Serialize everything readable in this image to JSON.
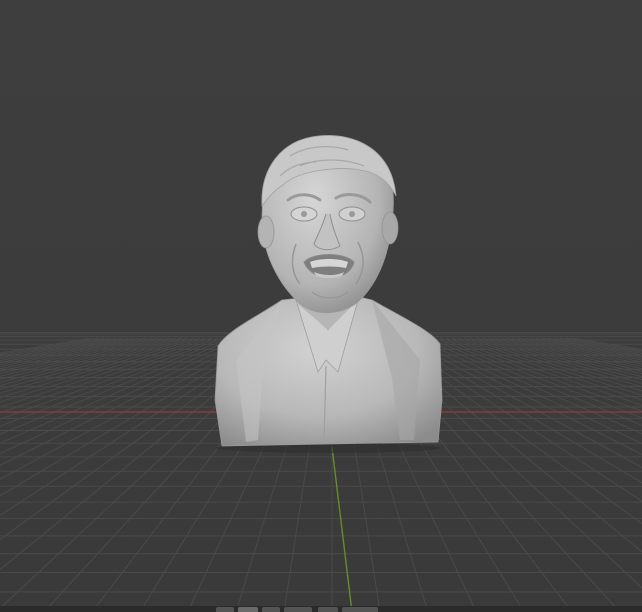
{
  "app": {
    "name": "",
    "view": "3D Viewport"
  },
  "viewport": {
    "background_color": "#3d3d3d",
    "grid_color": "#4a4a4a",
    "x_axis_color": "#8a3a3a",
    "y_axis_color": "#6a8a2a",
    "shading": "solid",
    "object": {
      "name": "",
      "material_color": "#bdbdbd"
    }
  },
  "bottom_toolbar": {
    "button_count": 6
  }
}
